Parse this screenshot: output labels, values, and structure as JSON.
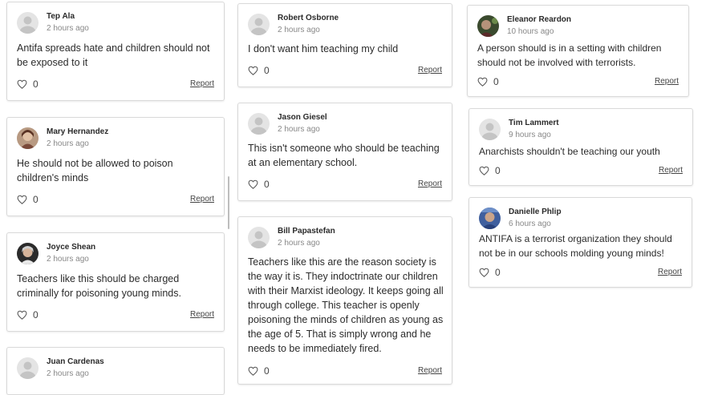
{
  "ui": {
    "report_label": "Report",
    "heart_icon": "heart-outline-icon"
  },
  "colors": {
    "text": "#2b2b2b",
    "meta": "#888888",
    "border": "#d9d9d9",
    "avatar_placeholder": "#e4e4e4"
  },
  "comments": [
    {
      "author": "Tep Ala",
      "time": "2 hours ago",
      "text": "Antifa spreads hate and children should not be exposed to it",
      "likes": "0"
    },
    {
      "author": "Mary Hernandez",
      "time": "2 hours ago",
      "text": "He should not be allowed to poison children's minds",
      "likes": "0"
    },
    {
      "author": "Joyce Shean",
      "time": "2 hours ago",
      "text": "Teachers like this should be charged criminally for poisoning young minds.",
      "likes": "0"
    },
    {
      "author": "Juan Cardenas",
      "time": "2 hours ago",
      "text": "",
      "likes": ""
    },
    {
      "author": "Robert Osborne",
      "time": "2 hours ago",
      "text": "I don't want him teaching my child",
      "likes": "0"
    },
    {
      "author": "Jason Giesel",
      "time": "2 hours ago",
      "text": "This isn't someone who should be teaching at an elementary school.",
      "likes": "0"
    },
    {
      "author": "Bill Papastefan",
      "time": "2 hours ago",
      "text": "Teachers like this are the reason society is the way it is. They indoctrinate our children with their Marxist ideology. It keeps going all through college. This teacher is openly poisoning the minds of children as young as the age of 5. That is simply wrong and he needs to be immediately fired.",
      "likes": "0"
    },
    {
      "author": "Eleanor Reardon",
      "time": "10 hours ago",
      "text": "A person should is in a setting with children should not be involved with terrorists.",
      "likes": "0"
    },
    {
      "author": "Tim Lammert",
      "time": "9 hours ago",
      "text": "Anarchists shouldn't be teaching our youth",
      "likes": "0"
    },
    {
      "author": "Danielle Phlip",
      "time": "6 hours ago",
      "text": "ANTIFA is a terrorist organization they should not be in our schools molding young minds!",
      "likes": "0"
    }
  ]
}
